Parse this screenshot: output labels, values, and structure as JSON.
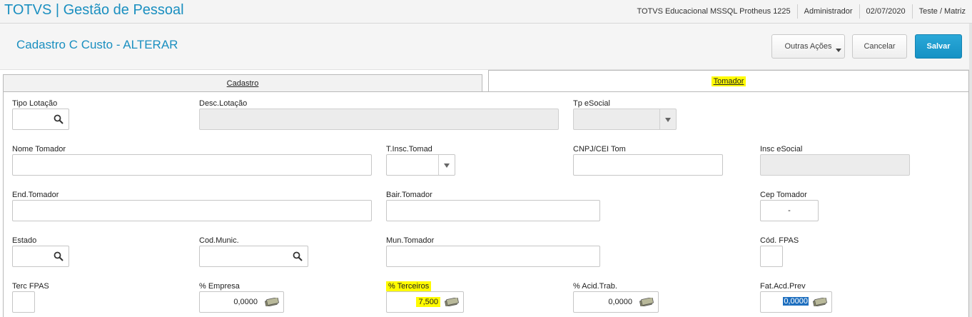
{
  "topbar": {
    "app_title": "TOTVS | Gestão de Pessoal",
    "environment": "TOTVS Educacional MSSQL Protheus 1225",
    "user": "Administrador",
    "date": "02/07/2020",
    "branch": "Teste / Matriz"
  },
  "header": {
    "title": "Cadastro C Custo - ALTERAR",
    "btn_outras": "Outras Ações",
    "btn_cancelar": "Cancelar",
    "btn_salvar": "Salvar"
  },
  "tabs": {
    "cadastro": "Cadastro",
    "tomador": "Tomador"
  },
  "fields": {
    "tipo_lotacao": {
      "label": "Tipo Lotação",
      "value": ""
    },
    "desc_lotacao": {
      "label": "Desc.Lotação",
      "value": ""
    },
    "tp_esocial": {
      "label": "Tp eSocial",
      "value": ""
    },
    "nome_tomador": {
      "label": "Nome Tomador",
      "value": ""
    },
    "t_insc_tomad": {
      "label": "T.Insc.Tomad",
      "value": ""
    },
    "cnpj_cei_tom": {
      "label": "CNPJ/CEI Tom",
      "value": ""
    },
    "insc_esocial": {
      "label": "Insc eSocial",
      "value": ""
    },
    "end_tomador": {
      "label": "End.Tomador",
      "value": ""
    },
    "bair_tomador": {
      "label": "Bair.Tomador",
      "value": ""
    },
    "cep_tomador": {
      "label": "Cep Tomador",
      "value": "-"
    },
    "estado": {
      "label": "Estado",
      "value": ""
    },
    "cod_munic": {
      "label": "Cod.Munic.",
      "value": ""
    },
    "mun_tomador": {
      "label": "Mun.Tomador",
      "value": ""
    },
    "cod_fpas": {
      "label": "Cód. FPAS",
      "value": ""
    },
    "terc_fpas": {
      "label": "Terc FPAS",
      "value": ""
    },
    "pct_empresa": {
      "label": "% Empresa",
      "value": "0,0000"
    },
    "pct_terceiros": {
      "label": "% Terceiros",
      "value": "7,500"
    },
    "pct_acid_trab": {
      "label": "% Acid.Trab.",
      "value": "0,0000"
    },
    "fat_acd_prev": {
      "label": "Fat.Acd.Prev",
      "value": "0,0000"
    }
  },
  "colors": {
    "accent": "#1a8fc0",
    "highlight": "#fffb00",
    "save_button": "#1591c4"
  }
}
